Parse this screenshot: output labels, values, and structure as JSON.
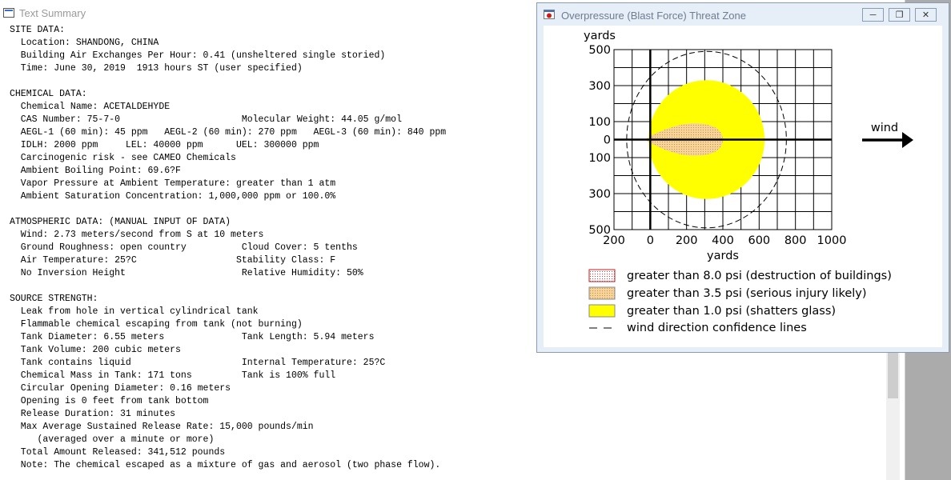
{
  "summary": {
    "title": "Text Summary",
    "lines": [
      "SITE DATA:",
      "  Location: SHANDONG, CHINA",
      "  Building Air Exchanges Per Hour: 0.41 (unsheltered single storied)",
      "  Time: June 30, 2019  1913 hours ST (user specified)",
      "",
      "CHEMICAL DATA:",
      "  Chemical Name: ACETALDEHYDE",
      "  CAS Number: 75-7-0                      Molecular Weight: 44.05 g/mol",
      "  AEGL-1 (60 min): 45 ppm   AEGL-2 (60 min): 270 ppm   AEGL-3 (60 min): 840 ppm",
      "  IDLH: 2000 ppm     LEL: 40000 ppm      UEL: 300000 ppm",
      "  Carcinogenic risk - see CAMEO Chemicals",
      "  Ambient Boiling Point: 69.6?F",
      "  Vapor Pressure at Ambient Temperature: greater than 1 atm",
      "  Ambient Saturation Concentration: 1,000,000 ppm or 100.0%",
      "",
      "ATMOSPHERIC DATA: (MANUAL INPUT OF DATA)",
      "  Wind: 2.73 meters/second from S at 10 meters",
      "  Ground Roughness: open country          Cloud Cover: 5 tenths",
      "  Air Temperature: 25?C                  Stability Class: F",
      "  No Inversion Height                     Relative Humidity: 50%",
      "",
      "SOURCE STRENGTH:",
      "  Leak from hole in vertical cylindrical tank",
      "  Flammable chemical escaping from tank (not burning)",
      "  Tank Diameter: 6.55 meters              Tank Length: 5.94 meters",
      "  Tank Volume: 200 cubic meters",
      "  Tank contains liquid                    Internal Temperature: 25?C",
      "  Chemical Mass in Tank: 171 tons         Tank is 100% full",
      "  Circular Opening Diameter: 0.16 meters",
      "  Opening is 0 feet from tank bottom",
      "  Release Duration: 31 minutes",
      "  Max Average Sustained Release Rate: 15,000 pounds/min",
      "     (averaged over a minute or more)",
      "  Total Amount Released: 341,512 pounds",
      "  Note: The chemical escaped as a mixture of gas and aerosol (two phase flow)."
    ]
  },
  "threat_window": {
    "title": "Overpressure (Blast Force) Threat Zone",
    "buttons": {
      "minimize": "─",
      "maximize": "❐",
      "close": "✕"
    },
    "wind_label": "wind",
    "legend": [
      {
        "label": "greater than 8.0 psi (destruction of buildings)",
        "fill": "#ffffff",
        "dots": "#e03030"
      },
      {
        "label": "greater than 3.5 psi (serious injury likely)",
        "fill": "#f5d39a",
        "dots": "#c8943a"
      },
      {
        "label": "greater than 1.0 psi (shatters glass)",
        "fill": "#ffff00",
        "dots": ""
      },
      {
        "label": "wind direction confidence lines",
        "fill": "",
        "dots": ""
      }
    ]
  },
  "chart_data": {
    "type": "scatter",
    "title": "",
    "xlabel": "yards",
    "ylabel": "yards",
    "xlim": [
      -200,
      1000
    ],
    "ylim": [
      -500,
      500
    ],
    "x_ticks": [
      "200",
      "0",
      "200",
      "400",
      "600",
      "800",
      "1000"
    ],
    "y_ticks": [
      "500",
      "300",
      "100",
      "0",
      "100",
      "300",
      "500"
    ],
    "grid": true,
    "zones": [
      {
        "name": "greater than 1.0 psi",
        "color": "#ffff00",
        "center_x": 310,
        "radius_x": 320,
        "radius_y": 330
      },
      {
        "name": "greater than 3.5 psi",
        "color": "#f5d39a",
        "x_range": [
          -30,
          400
        ],
        "half_width": 90
      }
    ],
    "confidence_line": {
      "center_x": 310,
      "radius_x": 440,
      "radius_y": 490
    },
    "wind_direction": "east"
  }
}
